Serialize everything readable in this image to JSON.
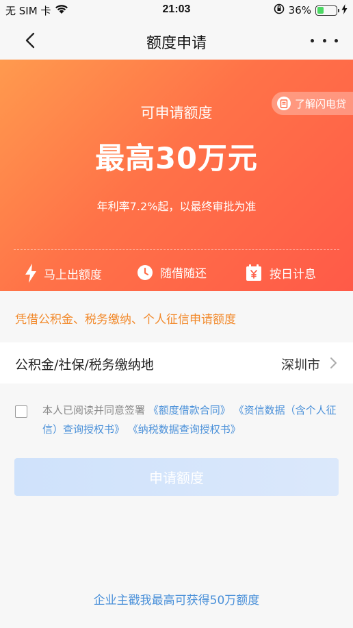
{
  "status_bar": {
    "carrier": "无 SIM 卡",
    "time": "21:03",
    "battery_percent": "36%",
    "battery_level": 0.36
  },
  "nav": {
    "title": "额度申请"
  },
  "hero": {
    "label": "可申请额度",
    "amount": "最高30万元",
    "rate": "年利率7.2%起，以最终审批为准",
    "learn_button": "了解闪电贷",
    "features": [
      "马上出额度",
      "随借随还",
      "按日计息"
    ]
  },
  "subtitle": "凭借公积金、税务缴纳、个人征信申请额度",
  "location": {
    "label": "公积金/社保/税务缴纳地",
    "value": "深圳市"
  },
  "agreement": {
    "prefix": "本人已阅读并同意签署",
    "links": [
      "《额度借款合同》",
      "《资信数据（含个人征信）查询授权书》",
      "《纳税数据查询授权书》"
    ]
  },
  "apply_button": "申请额度",
  "footer_link": "企业主戳我最高可获得50万额度",
  "colors": {
    "accent": "#ff6a48",
    "subtitle": "#f28a2c",
    "link": "#4a90d9",
    "button_disabled": "#d3e5fb"
  },
  "icons": [
    "wifi-icon",
    "orientation-lock-icon",
    "charging-icon",
    "back-chevron-icon",
    "more-icon",
    "lightning-icon",
    "clock-icon",
    "calendar-yen-icon",
    "chevron-right-icon"
  ]
}
